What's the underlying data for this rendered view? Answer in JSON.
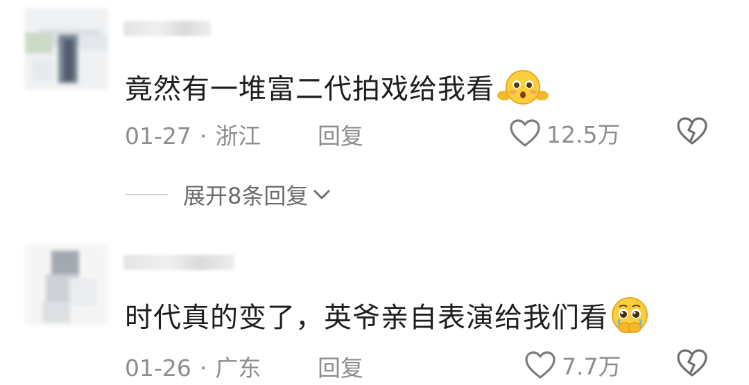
{
  "comments": [
    {
      "text": "竟然有一堆富二代拍戏给我看",
      "emoji": "surprised-face-emoji",
      "date": "01-27",
      "separator": "·",
      "location": "浙江",
      "reply_label": "回复",
      "likes": "12.5万",
      "expand_replies": "展开8条回复"
    },
    {
      "text": "时代真的变了，英爷亲自表演给我们看",
      "emoji": "teary-eyed-face-emoji",
      "date": "01-26",
      "separator": "·",
      "location": "广东",
      "reply_label": "回复",
      "likes": "7.7万"
    }
  ],
  "icons": {
    "like": "heart-outline-icon",
    "dislike": "broken-heart-icon",
    "expand": "chevron-down-icon"
  },
  "colors": {
    "text": "#1e1e1e",
    "meta": "#8d8d8d",
    "emoji": "#f7c42b"
  }
}
